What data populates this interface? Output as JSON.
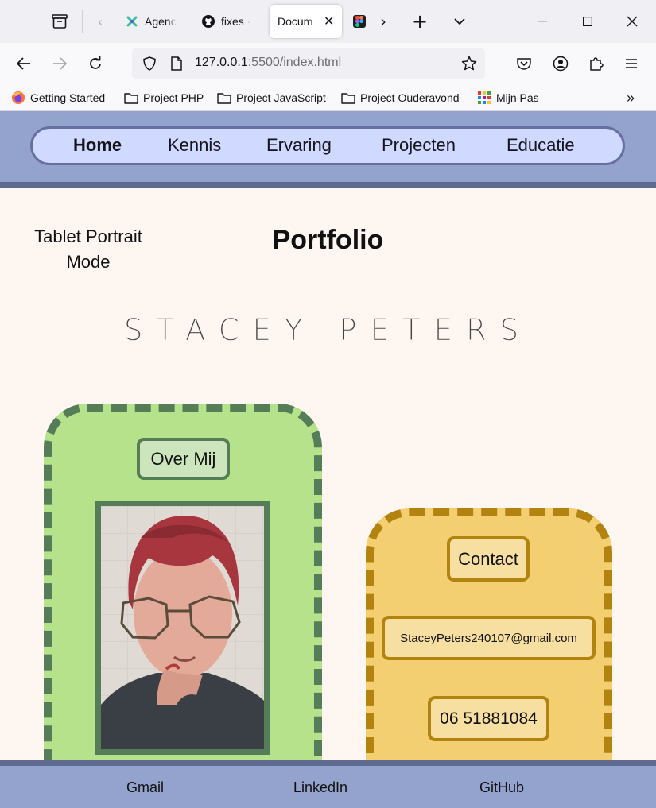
{
  "browser": {
    "tabs": [
      {
        "label": "Agenc",
        "icon": "agenda-icon"
      },
      {
        "label": "fixes ·",
        "icon": "github-icon"
      },
      {
        "label": "Docum",
        "icon": "document-icon",
        "active": true
      },
      {
        "label": "",
        "icon": "figma-icon"
      }
    ],
    "url_host": "127.0.0.1",
    "url_path": ":5500/index.html",
    "bookmarks": [
      {
        "label": "Getting Started",
        "icon": "firefox-icon"
      },
      {
        "label": "Project PHP",
        "icon": "folder-icon"
      },
      {
        "label": "Project JavaScript",
        "icon": "folder-icon"
      },
      {
        "label": "Project Ouderavond",
        "icon": "folder-icon"
      },
      {
        "label": "Mijn Pas",
        "icon": "grid-icon"
      }
    ]
  },
  "site": {
    "menu": [
      {
        "label": "Home",
        "current": true
      },
      {
        "label": "Kennis"
      },
      {
        "label": "Ervaring"
      },
      {
        "label": "Projecten"
      },
      {
        "label": "Educatie"
      }
    ],
    "mode_label": "Tablet Portrait Mode",
    "title": "Portfolio",
    "name": "STACEY PETERS",
    "about": {
      "heading": "Over Mij"
    },
    "contact": {
      "heading": "Contact",
      "email": "StaceyPeters240107@gmail.com",
      "phone": "06 51881084"
    },
    "footer_links": [
      "Gmail",
      "LinkedIn",
      "GitHub"
    ]
  },
  "colors": {
    "header_bg": "#94a3cd",
    "menu_bg": "#d0d9ff",
    "page_bg": "#fdf6f1",
    "about_card": "#b6e28c",
    "about_border": "#547d58",
    "contact_card": "#f3cf72",
    "contact_border": "#b2830f"
  }
}
